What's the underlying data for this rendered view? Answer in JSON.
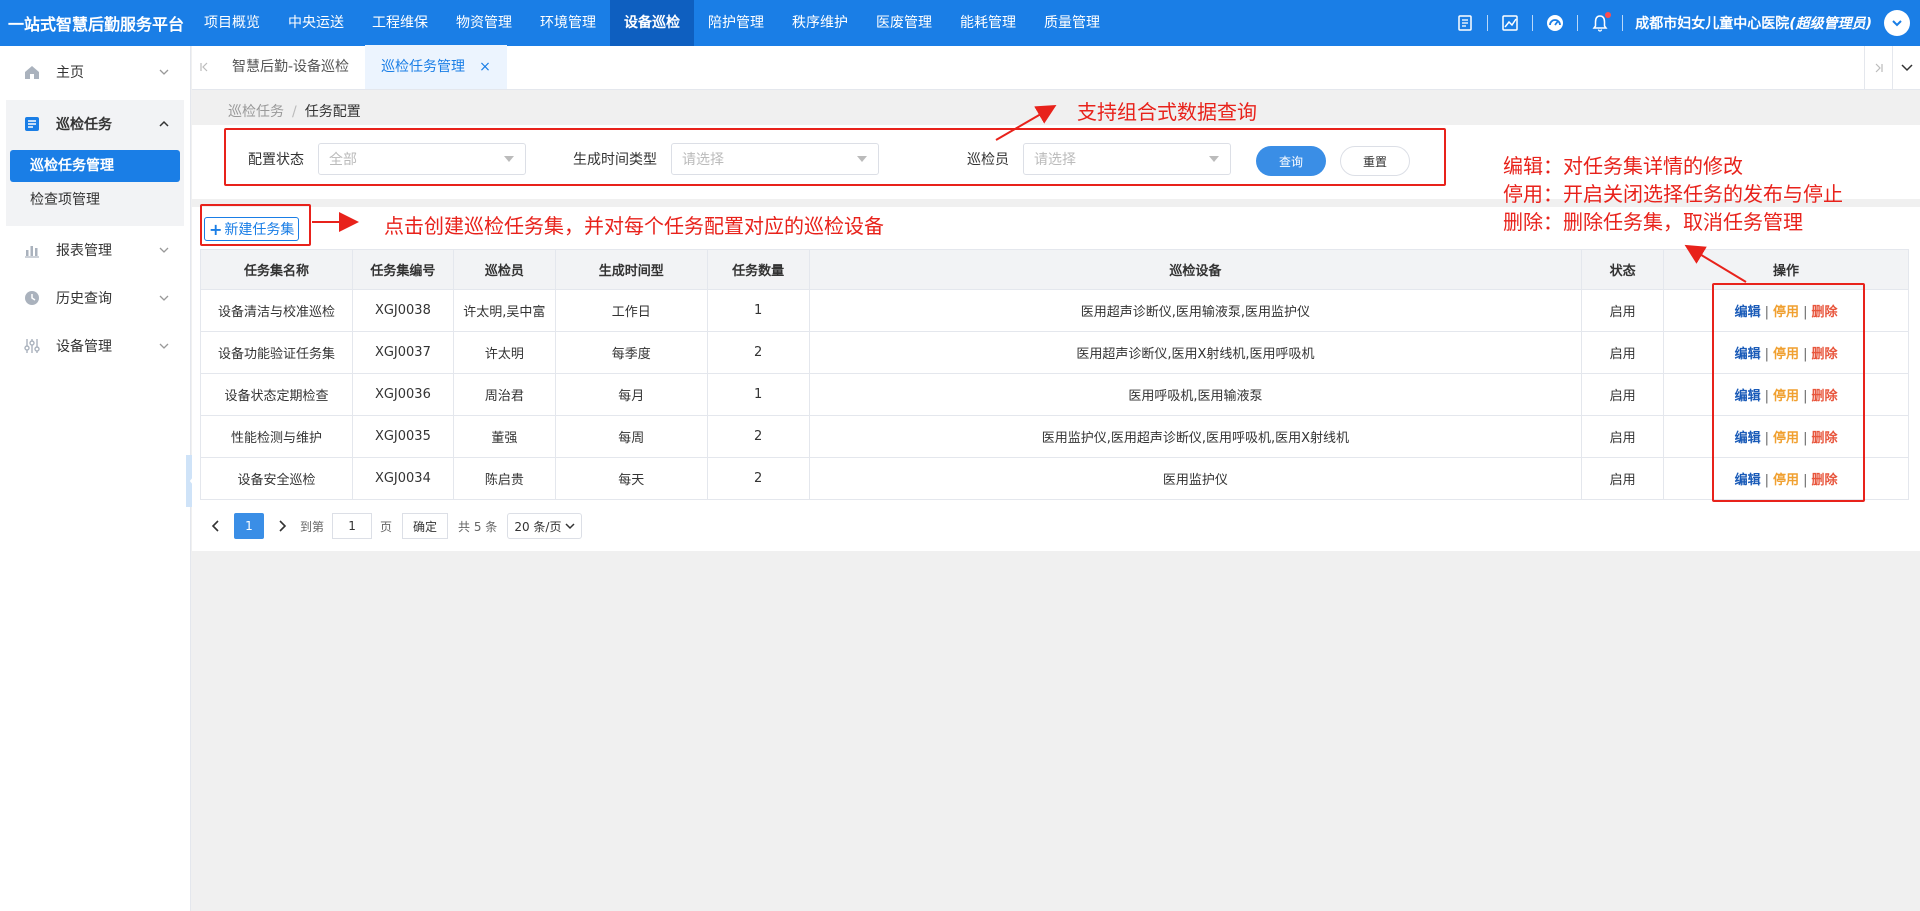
{
  "topbar": {
    "brand": "一站式智慧后勤服务平台",
    "nav": [
      {
        "label": "项目概览",
        "active": false
      },
      {
        "label": "中央运送",
        "active": false
      },
      {
        "label": "工程维保",
        "active": false
      },
      {
        "label": "物资管理",
        "active": false
      },
      {
        "label": "环境管理",
        "active": false
      },
      {
        "label": "设备巡检",
        "active": true
      },
      {
        "label": "陪护管理",
        "active": false
      },
      {
        "label": "秩序维护",
        "active": false
      },
      {
        "label": "医废管理",
        "active": false
      },
      {
        "label": "能耗管理",
        "active": false
      },
      {
        "label": "质量管理",
        "active": false
      }
    ],
    "user_org": "成都市妇女儿童中心医院",
    "user_role": "(超级管理员)",
    "icons": [
      "document-icon",
      "chart-icon",
      "dashboard-icon",
      "bell-icon",
      "chevron-down-icon"
    ]
  },
  "sidebar": {
    "items": [
      {
        "label": "主页",
        "icon": "home-icon"
      },
      {
        "label": "巡检任务",
        "icon": "task-icon",
        "expanded": true,
        "children": [
          {
            "label": "巡检任务管理",
            "active": true
          },
          {
            "label": "检查项管理",
            "active": false
          }
        ]
      },
      {
        "label": "报表管理",
        "icon": "bar-chart-icon"
      },
      {
        "label": "历史查询",
        "icon": "history-icon"
      },
      {
        "label": "设备管理",
        "icon": "sliders-icon"
      }
    ]
  },
  "tabs": {
    "items": [
      {
        "label": "智慧后勤-设备巡检",
        "active": false
      },
      {
        "label": "巡检任务管理",
        "active": true,
        "close": "×"
      }
    ]
  },
  "breadcrumb": {
    "parent": "巡检任务",
    "sep": "/",
    "current": "任务配置"
  },
  "search": {
    "status_label": "配置状态",
    "status_value": "全部",
    "timetype_label": "生成时间类型",
    "timetype_placeholder": "请选择",
    "inspector_label": "巡检员",
    "inspector_placeholder": "请选择",
    "query_button": "查询",
    "reset_button": "重置"
  },
  "table": {
    "new_button": "新建任务集",
    "new_button_plus": "+",
    "headers": [
      "任务集名称",
      "任务集编号",
      "巡检员",
      "生成时间型",
      "任务数量",
      "巡检设备",
      "状态",
      "操作"
    ],
    "rows": [
      {
        "name": "设备清洁与校准巡检",
        "code": "XGJ0038",
        "inspector": "许太明,吴中富",
        "time_type": "工作日",
        "count": "1",
        "devices": "医用超声诊断仪,医用输液泵,医用监护仪",
        "status": "启用"
      },
      {
        "name": "设备功能验证任务集",
        "code": "XGJ0037",
        "inspector": "许太明",
        "time_type": "每季度",
        "count": "2",
        "devices": "医用超声诊断仪,医用X射线机,医用呼吸机",
        "status": "启用"
      },
      {
        "name": "设备状态定期检查",
        "code": "XGJ0036",
        "inspector": "周治君",
        "time_type": "每月",
        "count": "1",
        "devices": "医用呼吸机,医用输液泵",
        "status": "启用"
      },
      {
        "name": "性能检测与维护",
        "code": "XGJ0035",
        "inspector": "董强",
        "time_type": "每周",
        "count": "2",
        "devices": "医用监护仪,医用超声诊断仪,医用呼吸机,医用X射线机",
        "status": "启用"
      },
      {
        "name": "设备安全巡检",
        "code": "XGJ0034",
        "inspector": "陈启贵",
        "time_type": "每天",
        "count": "2",
        "devices": "医用监护仪",
        "status": "启用"
      }
    ],
    "ops": {
      "edit": "编辑",
      "stop": "停用",
      "delete": "删除",
      "sep": "|"
    }
  },
  "pager": {
    "current": "1",
    "goto_label": "到第",
    "goto_value": "1",
    "page_unit": "页",
    "confirm": "确定",
    "total": "共 5 条",
    "page_size": "20 条/页"
  },
  "annotations": {
    "query_note": "支持组合式数据查询",
    "create_note": "点击创建巡检任务集，并对每个任务配置对应的巡检设备",
    "edit_note": "编辑：对任务集详情的修改",
    "stop_note": "停用：开启关闭选择任务的发布与停止",
    "delete_note": "删除：删除任务集，取消任务管理",
    "color": "#e8221b"
  },
  "colors": {
    "primary": "#1a7ee6",
    "nav_active": "#0e5fc0",
    "edit": "#1a5bb8",
    "stop": "#f0a030",
    "delete": "#e8563d"
  }
}
